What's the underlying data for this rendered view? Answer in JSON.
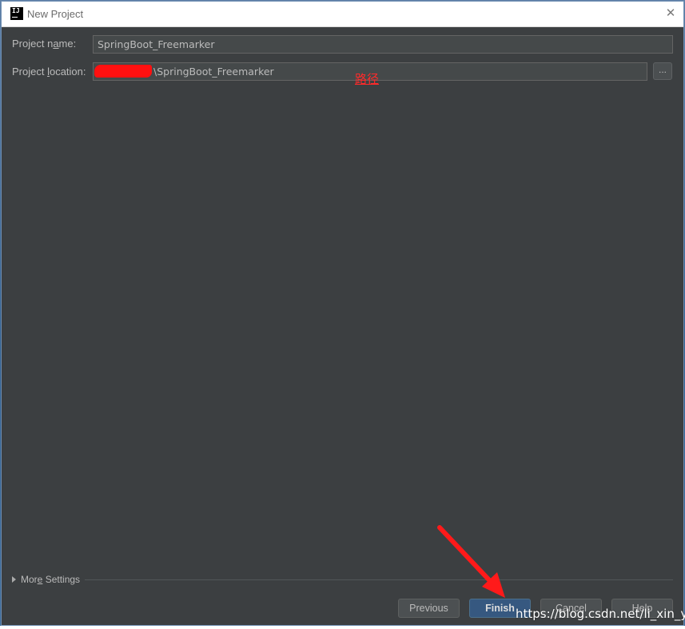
{
  "window": {
    "title": "New Project",
    "close_glyph": "✕"
  },
  "form": {
    "project_name_label_pre": "Project n",
    "project_name_label_mnemonic": "a",
    "project_name_label_post": "me:",
    "project_name_value": "SpringBoot_Freemarker",
    "project_location_label_pre": "Project ",
    "project_location_label_mnemonic": "l",
    "project_location_label_post": "ocation:",
    "project_location_value": "\\SpringBoot_Freemarker",
    "browse_label": "..."
  },
  "annotation": {
    "text": "路径",
    "color": "#ff2a2a"
  },
  "more_settings": {
    "label_pre": "Mor",
    "label_mnemonic": "e",
    "label_post": " Settings"
  },
  "buttons": {
    "previous": "Previous",
    "finish": "Finish",
    "cancel": "Cancel",
    "help": "Help"
  },
  "watermark": "https://blog.csdn.net/li_xin_yi",
  "colors": {
    "dialog_bg": "#3c3f41",
    "input_bg": "#45494a",
    "primary_button": "#365880",
    "arrow": "#ff1a1a"
  }
}
